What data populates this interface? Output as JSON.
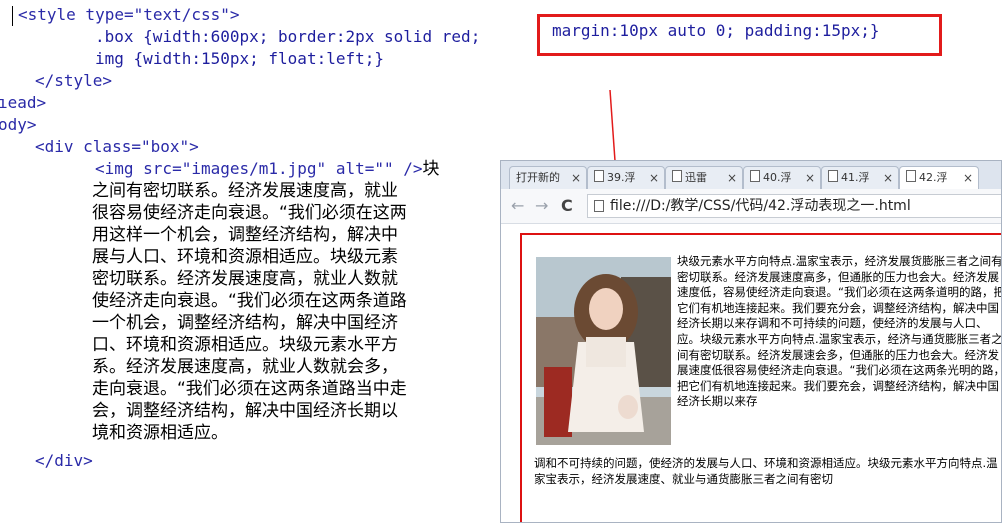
{
  "code": {
    "line1": {
      "open": "<style type=\"text/css\">"
    },
    "line2": {
      "selector": ".box",
      "props": "{width:600px; border:2px solid red;"
    },
    "highlight": "margin:10px auto 0; padding:15px;}",
    "line3": {
      "selector": "img",
      "props": "{width:150px; float:left;}"
    },
    "line4": "</style>",
    "line5": "ıead>",
    "line6": "ody>",
    "line7": "<div class=\"box\">",
    "line8": {
      "code": "<img src=\"images/m1.jpg\" alt=\"\" />",
      "cn": "块"
    },
    "cn_lines": [
      "之间有密切联系。经济发展速度高，就业",
      "很容易使经济走向衰退。“我们必须在这两",
      "用这样一个机会，调整经济结构，解决中",
      "展与人口、环境和资源相适应。块级元素",
      "密切联系。经济发展速度高，就业人数就",
      "使经济走向衰退。“我们必须在这两条道路",
      "一个机会，调整经济结构，解决中国经济",
      "口、环境和资源相适应。块级元素水平方",
      "系。经济发展速度高，就业人数就会多，",
      "走向衰退。“我们必须在这两条道路当中走",
      "会，调整经济结构，解决中国经济长期以",
      "境和资源相适应。"
    ],
    "line_close": "</div>"
  },
  "browser": {
    "tabs": [
      {
        "label": "打开新的"
      },
      {
        "label": "39.浮"
      },
      {
        "label": "迅雷"
      },
      {
        "label": "40.浮"
      },
      {
        "label": "41.浮"
      },
      {
        "label": "42.浮"
      }
    ],
    "url": "file:///D:/教学/CSS/代码/42.浮动表现之一.html",
    "page_text_top": "块级元素水平方向特点.温家宝表示，经济发展货膨胀三者之间有密切联系。经济发展速度高多，但通胀的压力也会大。经济发展速度低，容易使经济走向衰退。“我们必须在这两条道明的路，把它们有机地连接起来。我们要充分会，调整经济结构，解决中国经济长期以来存调和不可持续的问题，使经济的发展与人口、应。块级元素水平方向特点.温家宝表示，经济与通货膨胀三者之间有密切联系。经济发展速会多，但通胀的压力也会大。经济发展速度低很容易使经济走向衰退。“我们必须在这两条光明的路，把它们有机地连接起来。我们要充会，调整经济结构，解决中国经济长期以来存",
    "page_text_bottom": "调和不可持续的问题，使经济的发展与人口、环境和资源相适应。块级元素水平方向特点.温家宝表示，经济发展速度、就业与通货膨胀三者之间有密切"
  }
}
